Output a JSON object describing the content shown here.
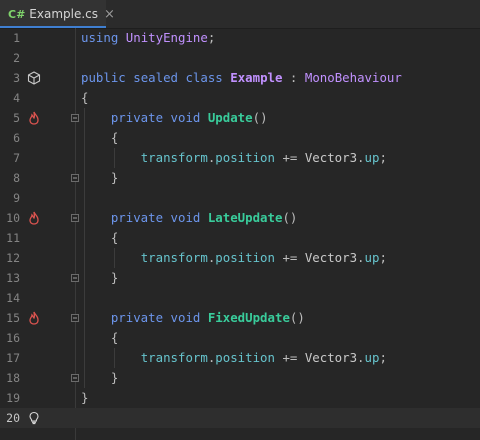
{
  "tab": {
    "lang": "C#",
    "filename": "Example.cs",
    "close": "×"
  },
  "colors": {
    "accent": "#3f7fd1",
    "keyword": "#6c95eb",
    "class": "#c191ff",
    "method": "#39cc9b"
  },
  "lines": [
    {
      "n": "1",
      "tokens": [
        [
          "kw",
          "using"
        ],
        [
          "plain",
          " "
        ],
        [
          "ty",
          "UnityEngine"
        ],
        [
          "plain",
          ";"
        ]
      ]
    },
    {
      "n": "2",
      "tokens": []
    },
    {
      "n": "3",
      "tokens": [
        [
          "kw",
          "public"
        ],
        [
          "plain",
          " "
        ],
        [
          "kw",
          "sealed"
        ],
        [
          "plain",
          " "
        ],
        [
          "kw",
          "class"
        ],
        [
          "plain",
          " "
        ],
        [
          "cls",
          "Example"
        ],
        [
          "plain",
          " : "
        ],
        [
          "ty",
          "MonoBehaviour"
        ]
      ],
      "icon": "unity-icon"
    },
    {
      "n": "4",
      "tokens": [
        [
          "plain",
          "{"
        ]
      ]
    },
    {
      "n": "5",
      "tokens": [
        [
          "plain",
          "    "
        ],
        [
          "kw",
          "private"
        ],
        [
          "plain",
          " "
        ],
        [
          "kw",
          "void"
        ],
        [
          "plain",
          " "
        ],
        [
          "mth",
          "Update"
        ],
        [
          "plain",
          "()"
        ]
      ],
      "icon": "hot-path-icon",
      "fold": true
    },
    {
      "n": "6",
      "tokens": [
        [
          "plain",
          "    {"
        ]
      ]
    },
    {
      "n": "7",
      "tokens": [
        [
          "plain",
          "        "
        ],
        [
          "prop",
          "transform"
        ],
        [
          "plain",
          "."
        ],
        [
          "prop",
          "position"
        ],
        [
          "plain",
          " += "
        ],
        [
          "v3",
          "Vector3"
        ],
        [
          "plain",
          "."
        ],
        [
          "up",
          "up"
        ],
        [
          "plain",
          ";"
        ]
      ]
    },
    {
      "n": "8",
      "tokens": [
        [
          "plain",
          "    }"
        ]
      ],
      "fold": true
    },
    {
      "n": "9",
      "tokens": []
    },
    {
      "n": "10",
      "tokens": [
        [
          "plain",
          "    "
        ],
        [
          "kw",
          "private"
        ],
        [
          "plain",
          " "
        ],
        [
          "kw",
          "void"
        ],
        [
          "plain",
          " "
        ],
        [
          "mth",
          "LateUpdate"
        ],
        [
          "plain",
          "()"
        ]
      ],
      "icon": "hot-path-icon",
      "fold": true
    },
    {
      "n": "11",
      "tokens": [
        [
          "plain",
          "    {"
        ]
      ]
    },
    {
      "n": "12",
      "tokens": [
        [
          "plain",
          "        "
        ],
        [
          "prop",
          "transform"
        ],
        [
          "plain",
          "."
        ],
        [
          "prop",
          "position"
        ],
        [
          "plain",
          " += "
        ],
        [
          "v3",
          "Vector3"
        ],
        [
          "plain",
          "."
        ],
        [
          "up",
          "up"
        ],
        [
          "plain",
          ";"
        ]
      ]
    },
    {
      "n": "13",
      "tokens": [
        [
          "plain",
          "    }"
        ]
      ],
      "fold": true
    },
    {
      "n": "14",
      "tokens": []
    },
    {
      "n": "15",
      "tokens": [
        [
          "plain",
          "    "
        ],
        [
          "kw",
          "private"
        ],
        [
          "plain",
          " "
        ],
        [
          "kw",
          "void"
        ],
        [
          "plain",
          " "
        ],
        [
          "mth",
          "FixedUpdate"
        ],
        [
          "plain",
          "()"
        ]
      ],
      "icon": "hot-path-icon",
      "fold": true
    },
    {
      "n": "16",
      "tokens": [
        [
          "plain",
          "    {"
        ]
      ]
    },
    {
      "n": "17",
      "tokens": [
        [
          "plain",
          "        "
        ],
        [
          "prop",
          "transform"
        ],
        [
          "plain",
          "."
        ],
        [
          "prop",
          "position"
        ],
        [
          "plain",
          " += "
        ],
        [
          "v3",
          "Vector3"
        ],
        [
          "plain",
          "."
        ],
        [
          "up",
          "up"
        ],
        [
          "plain",
          ";"
        ]
      ]
    },
    {
      "n": "18",
      "tokens": [
        [
          "plain",
          "    }"
        ]
      ],
      "fold": true
    },
    {
      "n": "19",
      "tokens": [
        [
          "plain",
          "}"
        ]
      ]
    },
    {
      "n": "20",
      "tokens": [],
      "icon": "lightbulb-icon",
      "current": true
    }
  ]
}
